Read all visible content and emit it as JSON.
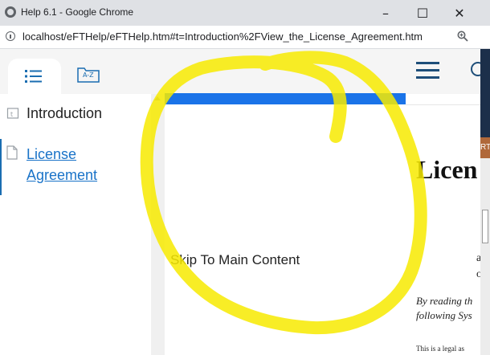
{
  "window": {
    "title": "Help 6.1 - Google Chrome",
    "minimize_glyph": "–",
    "maximize_glyph": "☐",
    "close_glyph": "✕"
  },
  "address_bar": {
    "url": "localhost/eFTHelp/eFTHelp.htm#t=Introduction%2FView_the_License_Agreement.htm"
  },
  "sidebar": {
    "tabs": [
      {
        "name": "toc-tab",
        "icon": "list-icon"
      },
      {
        "name": "index-tab",
        "icon": "a-z-folder-icon",
        "label": "A-Z"
      }
    ],
    "items": [
      {
        "label": "Introduction",
        "icon": "book-icon"
      },
      {
        "label": "License Agreement",
        "icon": "document-icon",
        "active": true
      }
    ]
  },
  "content": {
    "skip_link": "Skip To Main Content",
    "heading_fragment": "Licen",
    "body_fragment_1": "as",
    "body_fragment_2": "of",
    "italic_line_1": "By reading th",
    "italic_line_2": "following Sys",
    "small_line": "This is a legal as"
  },
  "right_panel": {
    "badge_text": "RT"
  },
  "colors": {
    "accent_blue": "#1a73e8",
    "link_blue": "#1a73c8",
    "menu_icon": "#1e4e79",
    "annotation_yellow": "#f7ea00"
  }
}
